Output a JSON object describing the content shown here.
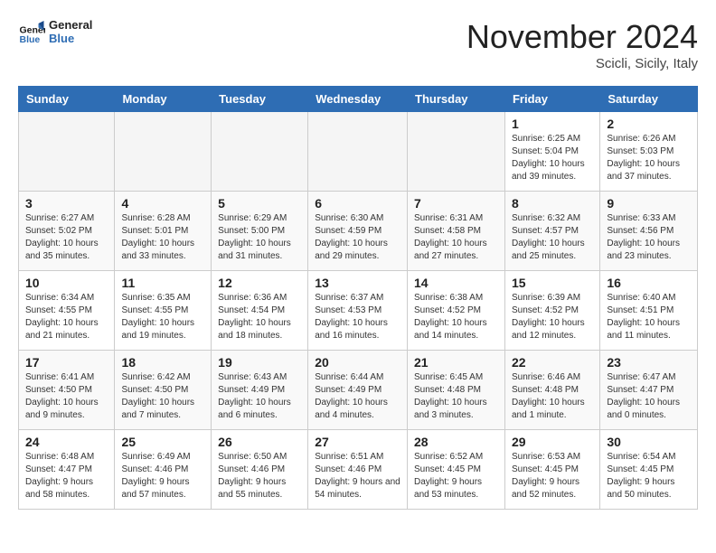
{
  "header": {
    "logo": {
      "general": "General",
      "blue": "Blue"
    },
    "title": "November 2024",
    "location": "Scicli, Sicily, Italy"
  },
  "weekdays": [
    "Sunday",
    "Monday",
    "Tuesday",
    "Wednesday",
    "Thursday",
    "Friday",
    "Saturday"
  ],
  "weeks": [
    [
      {
        "day": null
      },
      {
        "day": null
      },
      {
        "day": null
      },
      {
        "day": null
      },
      {
        "day": null
      },
      {
        "day": 1,
        "sunrise": "6:25 AM",
        "sunset": "5:04 PM",
        "daylight": "10 hours and 39 minutes."
      },
      {
        "day": 2,
        "sunrise": "6:26 AM",
        "sunset": "5:03 PM",
        "daylight": "10 hours and 37 minutes."
      }
    ],
    [
      {
        "day": 3,
        "sunrise": "6:27 AM",
        "sunset": "5:02 PM",
        "daylight": "10 hours and 35 minutes."
      },
      {
        "day": 4,
        "sunrise": "6:28 AM",
        "sunset": "5:01 PM",
        "daylight": "10 hours and 33 minutes."
      },
      {
        "day": 5,
        "sunrise": "6:29 AM",
        "sunset": "5:00 PM",
        "daylight": "10 hours and 31 minutes."
      },
      {
        "day": 6,
        "sunrise": "6:30 AM",
        "sunset": "4:59 PM",
        "daylight": "10 hours and 29 minutes."
      },
      {
        "day": 7,
        "sunrise": "6:31 AM",
        "sunset": "4:58 PM",
        "daylight": "10 hours and 27 minutes."
      },
      {
        "day": 8,
        "sunrise": "6:32 AM",
        "sunset": "4:57 PM",
        "daylight": "10 hours and 25 minutes."
      },
      {
        "day": 9,
        "sunrise": "6:33 AM",
        "sunset": "4:56 PM",
        "daylight": "10 hours and 23 minutes."
      }
    ],
    [
      {
        "day": 10,
        "sunrise": "6:34 AM",
        "sunset": "4:55 PM",
        "daylight": "10 hours and 21 minutes."
      },
      {
        "day": 11,
        "sunrise": "6:35 AM",
        "sunset": "4:55 PM",
        "daylight": "10 hours and 19 minutes."
      },
      {
        "day": 12,
        "sunrise": "6:36 AM",
        "sunset": "4:54 PM",
        "daylight": "10 hours and 18 minutes."
      },
      {
        "day": 13,
        "sunrise": "6:37 AM",
        "sunset": "4:53 PM",
        "daylight": "10 hours and 16 minutes."
      },
      {
        "day": 14,
        "sunrise": "6:38 AM",
        "sunset": "4:52 PM",
        "daylight": "10 hours and 14 minutes."
      },
      {
        "day": 15,
        "sunrise": "6:39 AM",
        "sunset": "4:52 PM",
        "daylight": "10 hours and 12 minutes."
      },
      {
        "day": 16,
        "sunrise": "6:40 AM",
        "sunset": "4:51 PM",
        "daylight": "10 hours and 11 minutes."
      }
    ],
    [
      {
        "day": 17,
        "sunrise": "6:41 AM",
        "sunset": "4:50 PM",
        "daylight": "10 hours and 9 minutes."
      },
      {
        "day": 18,
        "sunrise": "6:42 AM",
        "sunset": "4:50 PM",
        "daylight": "10 hours and 7 minutes."
      },
      {
        "day": 19,
        "sunrise": "6:43 AM",
        "sunset": "4:49 PM",
        "daylight": "10 hours and 6 minutes."
      },
      {
        "day": 20,
        "sunrise": "6:44 AM",
        "sunset": "4:49 PM",
        "daylight": "10 hours and 4 minutes."
      },
      {
        "day": 21,
        "sunrise": "6:45 AM",
        "sunset": "4:48 PM",
        "daylight": "10 hours and 3 minutes."
      },
      {
        "day": 22,
        "sunrise": "6:46 AM",
        "sunset": "4:48 PM",
        "daylight": "10 hours and 1 minute."
      },
      {
        "day": 23,
        "sunrise": "6:47 AM",
        "sunset": "4:47 PM",
        "daylight": "10 hours and 0 minutes."
      }
    ],
    [
      {
        "day": 24,
        "sunrise": "6:48 AM",
        "sunset": "4:47 PM",
        "daylight": "9 hours and 58 minutes."
      },
      {
        "day": 25,
        "sunrise": "6:49 AM",
        "sunset": "4:46 PM",
        "daylight": "9 hours and 57 minutes."
      },
      {
        "day": 26,
        "sunrise": "6:50 AM",
        "sunset": "4:46 PM",
        "daylight": "9 hours and 55 minutes."
      },
      {
        "day": 27,
        "sunrise": "6:51 AM",
        "sunset": "4:46 PM",
        "daylight": "9 hours and 54 minutes."
      },
      {
        "day": 28,
        "sunrise": "6:52 AM",
        "sunset": "4:45 PM",
        "daylight": "9 hours and 53 minutes."
      },
      {
        "day": 29,
        "sunrise": "6:53 AM",
        "sunset": "4:45 PM",
        "daylight": "9 hours and 52 minutes."
      },
      {
        "day": 30,
        "sunrise": "6:54 AM",
        "sunset": "4:45 PM",
        "daylight": "9 hours and 50 minutes."
      }
    ]
  ]
}
